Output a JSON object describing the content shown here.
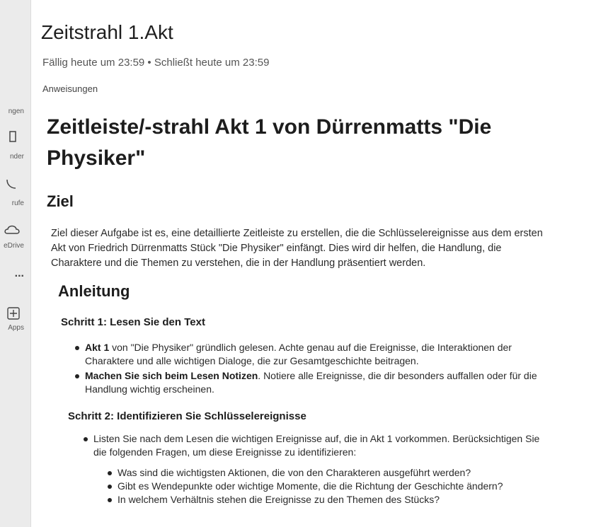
{
  "rail": {
    "items": [
      {
        "label": "ngen"
      },
      {
        "label": "nder"
      },
      {
        "label": "rufe"
      },
      {
        "label": "eDrive"
      },
      {
        "label": "Apps"
      }
    ],
    "more_label": "..."
  },
  "assignment": {
    "title": "Zeitstrahl 1.Akt",
    "due": "Fällig heute um 23:59 • Schließt heute um 23:59",
    "instructions_label": "Anweisungen"
  },
  "doc": {
    "title": "Zeitleiste/-strahl Akt 1 von Dürrenmatts \"Die Physiker\"",
    "goal_heading": "Ziel",
    "goal_text": "Ziel dieser Aufgabe ist es, eine detaillierte Zeitleiste zu erstellen, die die Schlüsselereignisse aus dem ersten Akt von Friedrich Dürrenmatts Stück \"Die Physiker\" einfängt. Dies wird dir helfen, die Handlung, die Charaktere und die Themen zu verstehen, die in der Handlung präsentiert werden.",
    "guide_heading": "Anleitung",
    "step1": {
      "heading": "Schritt 1: Lesen Sie den Text",
      "items": [
        {
          "bold": "Akt 1",
          "text": " von \"Die Physiker\" gründlich gelesen. Achte genau auf die Ereignisse, die Interaktionen der Charaktere und alle wichtigen Dialoge, die zur Gesamtgeschichte beitragen."
        },
        {
          "bold": "Machen Sie sich beim Lesen Notizen",
          "text": ". Notiere alle Ereignisse, die dir besonders auffallen oder für die Handlung wichtig erscheinen."
        }
      ]
    },
    "step2": {
      "heading": "Schritt 2: Identifizieren Sie Schlüsselereignisse",
      "item": "Listen Sie nach dem Lesen die wichtigen Ereignisse auf, die in Akt 1 vorkommen. Berücksichtigen Sie die folgenden Fragen, um diese Ereignisse zu identifizieren:",
      "questions": [
        "Was sind die wichtigsten Aktionen, die von den Charakteren ausgeführt werden?",
        "Gibt es Wendepunkte oder wichtige Momente, die die Richtung der Geschichte ändern?",
        "In welchem Verhältnis stehen die Ereignisse zu den Themen des Stücks?"
      ]
    }
  }
}
